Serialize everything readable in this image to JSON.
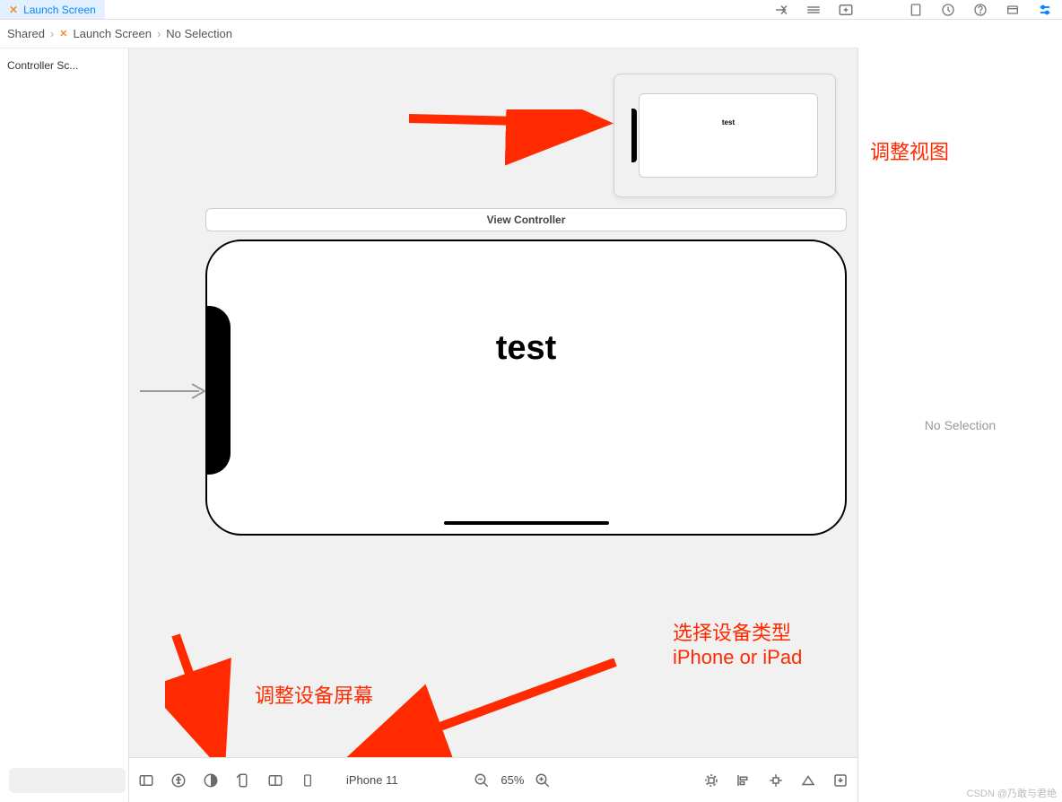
{
  "tab": {
    "active_label": "Launch Screen"
  },
  "breadcrumb": {
    "items": [
      "Shared",
      "Launch Screen",
      "No Selection"
    ]
  },
  "outline": {
    "item": "Controller Sc..."
  },
  "minimap": {
    "text": "test"
  },
  "scene": {
    "header": "View Controller",
    "content": "test"
  },
  "bottom": {
    "device": "iPhone 11",
    "zoom": "65%"
  },
  "inspector": {
    "placeholder": "No Selection"
  },
  "annotations": {
    "top": "调整视图",
    "bottom_left": "调整设备屏幕",
    "bottom_right_l1": "选择设备类型",
    "bottom_right_l2": "iPhone or iPad"
  },
  "watermark": "CSDN @乃敢与君绝"
}
